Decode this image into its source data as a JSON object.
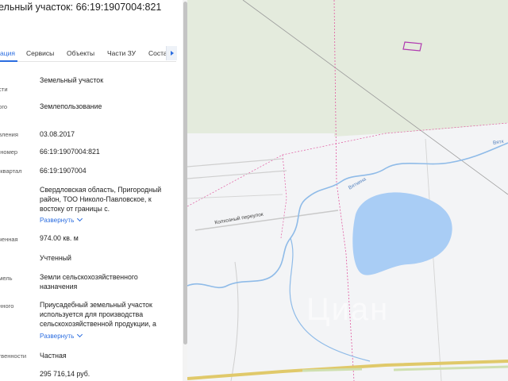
{
  "panel": {
    "title": "ельный участок: 66:19:1907004:821",
    "tabs": [
      "ация",
      "Сервисы",
      "Объекты",
      "Части ЗУ",
      "Соста"
    ],
    "rows": [
      {
        "label1": "а",
        "label2": "ости",
        "value": "Земельный участок"
      },
      {
        "label1": "ного",
        "value": "Землепользование"
      },
      {
        "label1": "овления",
        "value": "03.08.2017"
      },
      {
        "label1": "й номер",
        "value": "66:19:1907004:821"
      },
      {
        "label1": "й квартал",
        "value": "66:19:1907004"
      },
      {
        "value": "Свердловская область, Пригородный район, ТОО Николо-Павловское, к востоку от границы с."
      },
      {
        "label1": "оченная",
        "value": "974.00 кв. м"
      },
      {
        "value": "Учтенный"
      },
      {
        "label1": "емель",
        "value": "Земли сельскохозяйственного назначения"
      },
      {
        "label1": "енного",
        "label2": "я",
        "value": "Приусадебный земельный участок используется для производства сельскохозяйственной продукции, а"
      },
      {
        "label1": "ственности",
        "value": "Частная"
      },
      {
        "label1": "я",
        "value": "295 716,14 руб."
      }
    ],
    "expand_label": "Развернуть"
  },
  "map": {
    "labels": {
      "lane": "Колхозный переулок",
      "river": "Вяткина",
      "river2": "Вятк",
      "watermark": "Циан"
    },
    "colors": {
      "background": "#f3f4f6",
      "field": "#e4ebdd",
      "lake": "#a9cdf5",
      "river": "#8fbbe8",
      "parcel": "#b03ab0",
      "road": "#e0c96a",
      "boundary": "#e05aa0"
    }
  }
}
